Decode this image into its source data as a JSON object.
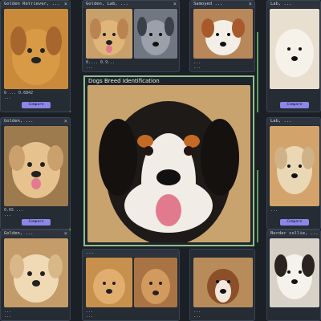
{
  "app_title": "Dogs Breed Identification",
  "cards": {
    "tl": {
      "hdr": "Golden Retriever, ...",
      "meta1": "6 ... 0.6842",
      "meta2": "...",
      "pill": "Compare"
    },
    "tm1": {
      "hdr": "Golden, Lab, ...",
      "meta1": "0.... 0.9...",
      "meta2": "..."
    },
    "tr1": {
      "hdr": "Samoyed ...",
      "meta1": "...",
      "meta2": "...",
      "pill": "Compare"
    },
    "ml": {
      "hdr": "Golden, ...",
      "meta1": "0.65 ...",
      "meta2": "...",
      "pill": "Compare"
    },
    "mr": {
      "hdr": "Lab, ...",
      "meta1": "...",
      "meta2": "...",
      "pill": "Compare"
    },
    "bl": {
      "hdr": "Golden, ...",
      "meta1": "...",
      "meta2": "..."
    },
    "bm": {
      "hdr": "...",
      "meta1": "...",
      "meta2": "..."
    },
    "br": {
      "hdr": "Border collie, ...",
      "meta1": "...",
      "meta2": "..."
    }
  }
}
